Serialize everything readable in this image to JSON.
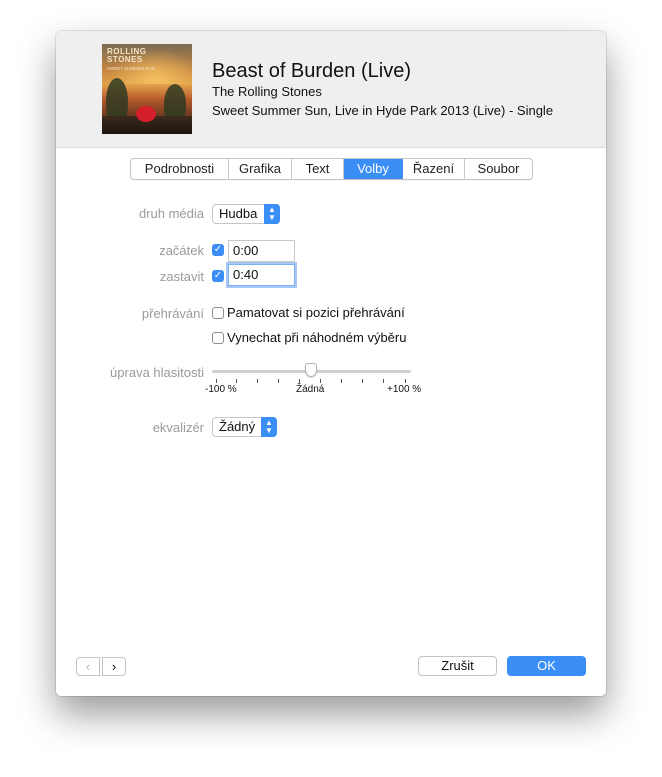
{
  "header": {
    "title": "Beast of Burden (Live)",
    "artist": "The Rolling Stones",
    "album": "Sweet Summer Sun, Live in Hyde Park 2013 (Live) - Single",
    "artwork_text_line1": "ROLLING",
    "artwork_text_line2": "STONES",
    "artwork_text_line3": "SWEET SUMMER SUN"
  },
  "tabs": [
    {
      "label": "Podrobnosti",
      "active": false
    },
    {
      "label": "Grafika",
      "active": false
    },
    {
      "label": "Text",
      "active": false
    },
    {
      "label": "Volby",
      "active": true
    },
    {
      "label": "Řazení",
      "active": false
    },
    {
      "label": "Soubor",
      "active": false
    }
  ],
  "options": {
    "media_kind": {
      "label": "druh média",
      "value": "Hudba"
    },
    "start": {
      "label": "začátek",
      "checked": true,
      "value": "0:00"
    },
    "stop": {
      "label": "zastavit",
      "checked": true,
      "value": "0:40"
    },
    "playback": {
      "label": "přehrávání",
      "remember_position": {
        "label": "Pamatovat si pozici přehrávání",
        "checked": false
      },
      "skip_shuffle": {
        "label": "Vynechat při náhodném výběru",
        "checked": false
      }
    },
    "volume": {
      "label": "úprava hlasitosti",
      "min_label": "-100 %",
      "mid_label": "Žádná",
      "max_label": "+100 %",
      "value_percent": 0
    },
    "equalizer": {
      "label": "ekvalizér",
      "value": "Žádný"
    }
  },
  "footer": {
    "prev_icon": "chevron-left-icon",
    "next_icon": "chevron-right-icon",
    "cancel_label": "Zrušit",
    "ok_label": "OK"
  },
  "colors": {
    "accent": "#3b8ef5",
    "header_bg": "#efefef",
    "label_gray": "#9a9a9a"
  }
}
